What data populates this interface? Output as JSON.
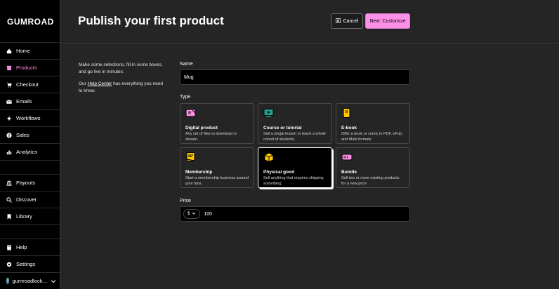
{
  "app": {
    "logo": "GUMROAD"
  },
  "sidebar": {
    "items": [
      {
        "label": "Home",
        "icon": "home-icon"
      },
      {
        "label": "Products",
        "icon": "archive-icon",
        "active": true
      },
      {
        "label": "Checkout",
        "icon": "cart-icon"
      },
      {
        "label": "Emails",
        "icon": "mail-icon"
      },
      {
        "label": "Workflows",
        "icon": "workflow-icon"
      },
      {
        "label": "Sales",
        "icon": "dollar-icon"
      },
      {
        "label": "Analytics",
        "icon": "bar-chart-icon"
      },
      {
        "label": "Payouts",
        "icon": "bank-icon"
      },
      {
        "label": "Discover",
        "icon": "search-icon"
      },
      {
        "label": "Library",
        "icon": "bookmark-icon"
      },
      {
        "label": "Help",
        "icon": "book-icon"
      },
      {
        "label": "Settings",
        "icon": "gear-icon"
      }
    ],
    "user": {
      "name": "gumroadlock…",
      "icon": "chevron-down-icon"
    }
  },
  "header": {
    "title": "Publish your first product",
    "cancel_label": "Cancel",
    "next_label": "Next: Customize"
  },
  "help": {
    "line1": "Make some selections, fill in some boxes, and go live in minutes.",
    "line2_prefix": "Our ",
    "line2_link": "Help Center",
    "line2_suffix": " has everything you need to know."
  },
  "form": {
    "name_label": "Name",
    "name_value": "Mug",
    "type_label": "Type",
    "types": [
      {
        "title": "Digital product",
        "desc": "Any set of files to download or stream.",
        "icon": "digital-product-icon",
        "color": "#ff90e8"
      },
      {
        "title": "Course or tutorial",
        "desc": "Sell a single lesson or teach a whole cohort of students.",
        "icon": "course-icon",
        "color": "#23a094"
      },
      {
        "title": "E-book",
        "desc": "Offer a book or comic in PDF, ePub, and Mobi formats.",
        "icon": "ebook-icon",
        "color": "#ffc900"
      },
      {
        "title": "Membership",
        "desc": "Start a membership business around your fans.",
        "icon": "membership-icon",
        "color": "#ffc900"
      },
      {
        "title": "Physical good",
        "desc": "Sell anything that requires shipping something.",
        "icon": "physical-good-icon",
        "color": "#ffc900",
        "selected": true
      },
      {
        "title": "Bundle",
        "desc": "Sell two or more existing products for a new price",
        "icon": "bundle-icon",
        "color": "#ff90e8"
      }
    ],
    "price_label": "Price",
    "currency": "$",
    "price_value": "100"
  },
  "colors": {
    "accent": "#ff90e8",
    "background": "#252525",
    "sidebar": "#000000"
  }
}
